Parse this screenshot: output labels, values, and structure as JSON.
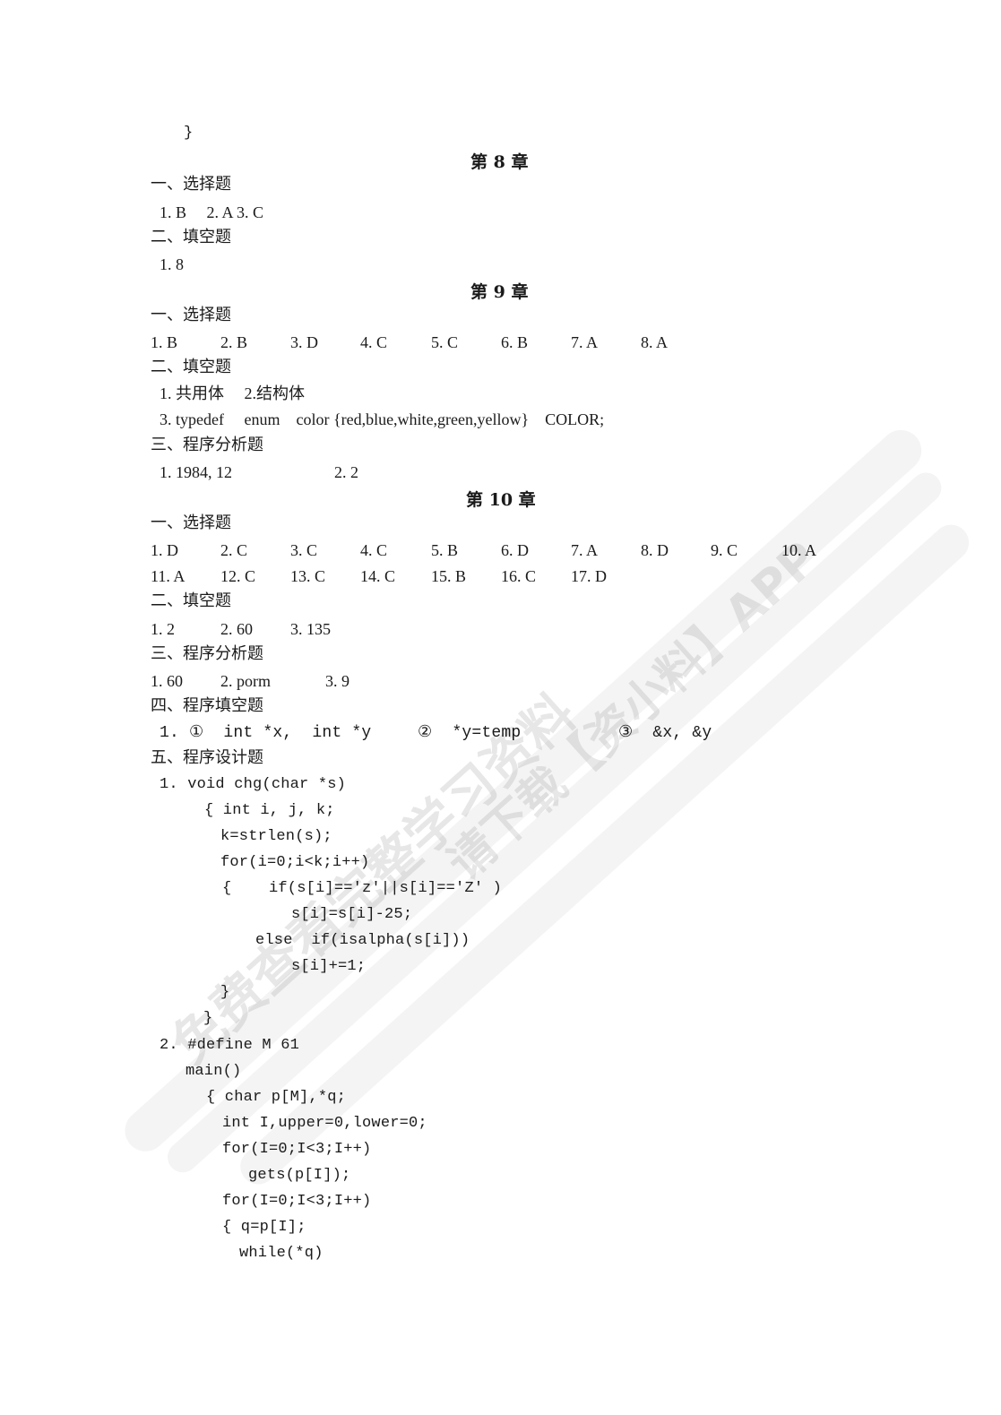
{
  "top_fragment": {
    "closing_brace": "}"
  },
  "ch8": {
    "title": "第 8 章",
    "sec1_title": "一、选择题",
    "sec1_answers": "1. B     2. A 3. C",
    "sec2_title": "二、填空题",
    "sec2_answers": "1. 8"
  },
  "ch9": {
    "title": "第 9 章",
    "sec1_title": "一、选择题",
    "sec1_answers": [
      "1. B",
      "2. B",
      "3. D",
      "4. C",
      "5. C",
      "6. B",
      "7. A",
      "8. A"
    ],
    "sec2_title": "二、填空题",
    "sec2_line1": "1. 共用体     2.结构体",
    "sec2_line2": "3. typedef     enum    color {red,blue,white,green,yellow}    COLOR;",
    "sec3_title": "三、程序分析题",
    "sec3_answers": [
      "1. 1984, 12",
      "2. 2"
    ]
  },
  "ch10": {
    "title": "第 10 章",
    "sec1_title": "一、选择题",
    "sec1_row1": [
      "1. D",
      "2. C",
      "3. C",
      "4. C",
      "5. B",
      "6. D",
      "7. A",
      "8. D",
      "9. C",
      "10. A"
    ],
    "sec1_row2": [
      "11. A",
      "12. C",
      "13. C",
      "14. C",
      "15. B",
      "16. C",
      "17. D"
    ],
    "sec2_title": "二、填空题",
    "sec2_answers": [
      "1. 2",
      "2. 60",
      "3. 135"
    ],
    "sec3_title": "三、程序分析题",
    "sec3_answers": [
      "1. 60",
      "2. porm",
      "3. 9"
    ],
    "sec4_title": "四、程序填空题",
    "sec4_answers": [
      "1. ①  int *x,  int *y",
      "②  *y=temp",
      "③  &x, &y"
    ],
    "sec5_title": "五、程序设计题",
    "code1": [
      "1. void chg(char *s)",
      "{ int i, j, k;",
      "k=strlen(s);",
      "for(i=0;i<k;i++)",
      "{    if(s[i]=='z'||s[i]=='Z' )",
      "s[i]=s[i]-25;",
      "else  if(isalpha(s[i]))",
      "s[i]+=1;",
      "}",
      "}"
    ],
    "code2": [
      "2. #define M 61",
      "main()",
      "{ char p[M],*q;",
      "int I,upper=0,lower=0;",
      "for(I=0;I<3;I++)",
      "gets(p[I]);",
      "for(I=0;I<3;I++)",
      "{ q=p[I];",
      "while(*q)"
    ]
  },
  "watermark": {
    "line1": "免费查看完整学习资料",
    "line2": "请下载【资小料】APP"
  }
}
